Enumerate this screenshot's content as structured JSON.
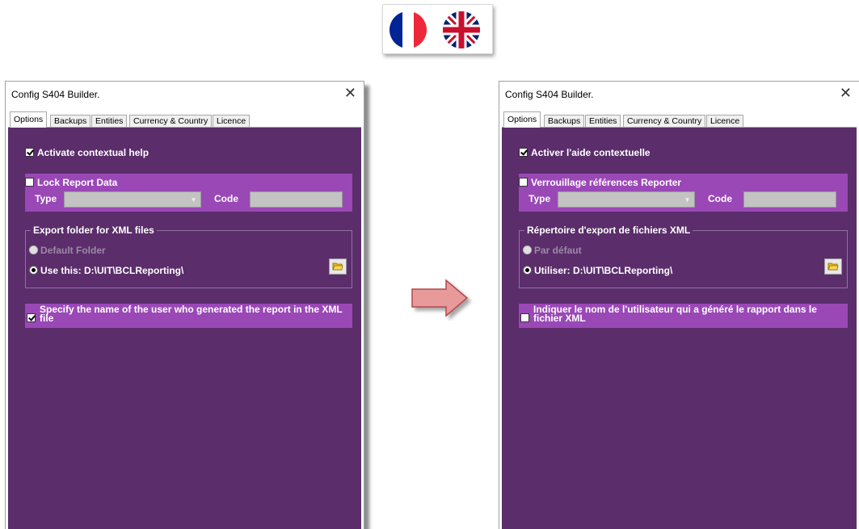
{
  "windows": [
    {
      "title": "Config S404 Builder.",
      "close_glyph": "✕",
      "tabs": [
        {
          "label": "Options",
          "active": true
        },
        {
          "label": "Backups",
          "active": false
        },
        {
          "label": "Entities",
          "active": false
        },
        {
          "label": "Currency & Country",
          "active": false
        },
        {
          "label": "Licence",
          "active": false
        }
      ],
      "contextual_help": {
        "label": "Activate contextual help",
        "checked": true
      },
      "lock_report": {
        "label": "Lock Report Data",
        "checked": false,
        "type_label": "Type",
        "code_label": "Code"
      },
      "export_folder": {
        "legend": "Export folder for XML files",
        "default_label": "Default Folder",
        "use_label": "Use this: D:\\UIT\\BCLReporting\\"
      },
      "user_name": {
        "label": "Specify the name of the user who generated the report in the XML file",
        "checked": true
      }
    },
    {
      "title": "Config S404 Builder.",
      "close_glyph": "✕",
      "tabs": [
        {
          "label": "Options",
          "active": true
        },
        {
          "label": "Backups",
          "active": false
        },
        {
          "label": "Entities",
          "active": false
        },
        {
          "label": "Currency & Country",
          "active": false
        },
        {
          "label": "Licence",
          "active": false
        }
      ],
      "contextual_help": {
        "label": "Activer l'aide contextuelle",
        "checked": true
      },
      "lock_report": {
        "label": "Verrouillage références Reporter",
        "checked": false,
        "type_label": "Type",
        "code_label": "Code"
      },
      "export_folder": {
        "legend": "Répertoire d'export de fichiers XML",
        "default_label": "Par défaut",
        "use_label": "Utiliser: D:\\UIT\\BCLReporting\\"
      },
      "user_name": {
        "label": "Indiquer le nom de l'utilisateur qui a généré le rapport dans le fichier XML",
        "checked": false
      }
    }
  ],
  "icons": {
    "flags": [
      "france-flag-icon",
      "uk-flag-icon"
    ],
    "arrow": "right-arrow-icon",
    "folder": "folder-icon"
  },
  "colors": {
    "panel_bg": "#5b2d6b",
    "section_bg": "#9a48b6",
    "arrow_fill": "#e89a9a",
    "arrow_stroke": "#b04848"
  }
}
